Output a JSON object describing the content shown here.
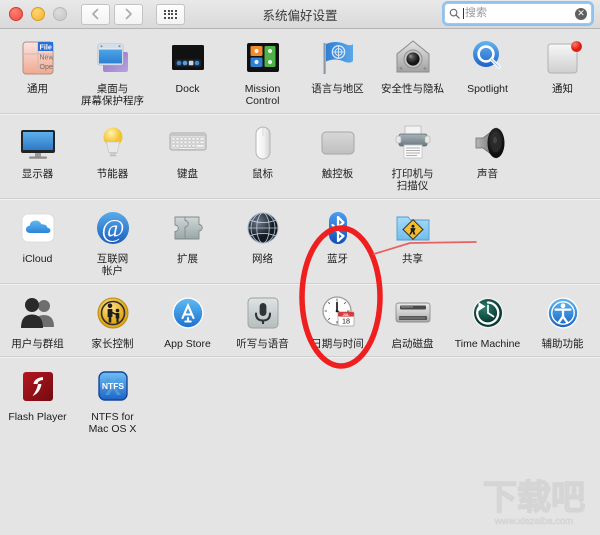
{
  "window": {
    "title": "系统偏好设置",
    "traffic_lights": [
      "close",
      "minimize",
      "zoom"
    ],
    "nav": {
      "back": "‹",
      "forward": "›",
      "grid": "show-all"
    }
  },
  "search": {
    "placeholder": "搜索",
    "value": "",
    "icon": "search-icon",
    "clear_icon": "clear-icon",
    "focused": true
  },
  "rows": [
    {
      "id": "personal",
      "panes": [
        {
          "id": "general",
          "label": "通用",
          "icon": "general-icon"
        },
        {
          "id": "desktop-screensaver",
          "label": "桌面与\n屏幕保护程序",
          "icon": "desktop-icon"
        },
        {
          "id": "dock",
          "label": "Dock",
          "icon": "dock-icon"
        },
        {
          "id": "mission-control",
          "label": "Mission\nControl",
          "icon": "mission-control-icon"
        },
        {
          "id": "language-region",
          "label": "语言与地区",
          "icon": "flag-icon"
        },
        {
          "id": "security-privacy",
          "label": "安全性与隐私",
          "icon": "security-icon"
        },
        {
          "id": "spotlight",
          "label": "Spotlight",
          "icon": "spotlight-icon"
        },
        {
          "id": "notifications",
          "label": "通知",
          "icon": "notifications-icon"
        }
      ]
    },
    {
      "id": "hardware",
      "panes": [
        {
          "id": "displays",
          "label": "显示器",
          "icon": "display-icon"
        },
        {
          "id": "energy-saver",
          "label": "节能器",
          "icon": "lightbulb-icon"
        },
        {
          "id": "keyboard",
          "label": "键盘",
          "icon": "keyboard-icon"
        },
        {
          "id": "mouse",
          "label": "鼠标",
          "icon": "mouse-icon"
        },
        {
          "id": "trackpad",
          "label": "触控板",
          "icon": "trackpad-icon"
        },
        {
          "id": "printers-scanners",
          "label": "打印机与\n扫描仪",
          "icon": "printer-icon"
        },
        {
          "id": "sound",
          "label": "声音",
          "icon": "speaker-icon"
        }
      ]
    },
    {
      "id": "internet-wireless",
      "panes": [
        {
          "id": "icloud",
          "label": "iCloud",
          "icon": "icloud-icon"
        },
        {
          "id": "internet-accounts",
          "label": "互联网\n帐户",
          "icon": "at-sign-icon"
        },
        {
          "id": "extensions",
          "label": "扩展",
          "icon": "puzzle-icon"
        },
        {
          "id": "network",
          "label": "网络",
          "icon": "globe-icon"
        },
        {
          "id": "bluetooth",
          "label": "蓝牙",
          "icon": "bluetooth-icon"
        },
        {
          "id": "sharing",
          "label": "共享",
          "icon": "sharing-folder-icon"
        }
      ]
    },
    {
      "id": "system",
      "panes": [
        {
          "id": "users-groups",
          "label": "用户与群组",
          "icon": "users-icon"
        },
        {
          "id": "parental-controls",
          "label": "家长控制",
          "icon": "parental-controls-icon"
        },
        {
          "id": "app-store",
          "label": "App Store",
          "icon": "app-store-icon"
        },
        {
          "id": "dictation-speech",
          "label": "听写与语音",
          "icon": "microphone-icon"
        },
        {
          "id": "date-time",
          "label": "日期与时间",
          "icon": "clock-icon",
          "badge_month": "JUL",
          "badge_day": "18"
        },
        {
          "id": "startup-disk",
          "label": "启动磁盘",
          "icon": "hard-drive-icon"
        },
        {
          "id": "time-machine",
          "label": "Time Machine",
          "icon": "time-machine-icon"
        },
        {
          "id": "accessibility",
          "label": "辅助功能",
          "icon": "accessibility-icon"
        }
      ]
    },
    {
      "id": "other",
      "panes": [
        {
          "id": "flash-player",
          "label": "Flash Player",
          "icon": "flash-player-icon"
        },
        {
          "id": "ntfs-for-mac",
          "label": "NTFS for\nMac OS X",
          "icon": "ntfs-icon"
        }
      ]
    }
  ],
  "annotation": {
    "highlight_target": "bluetooth",
    "shape": "ellipse",
    "color": "#f01f1f",
    "leader_line_color": "#e8605f"
  },
  "watermark": {
    "text": "下载吧",
    "url": "www.xiazaiba.com"
  },
  "colors": {
    "window_bg": "#e4e4e4",
    "titlebar_top": "#e9e9e9",
    "titlebar_bottom": "#d9d9d9",
    "divider": "#cfcfcf",
    "label_text": "#1d1d1d",
    "accent": "#3b8fde"
  }
}
